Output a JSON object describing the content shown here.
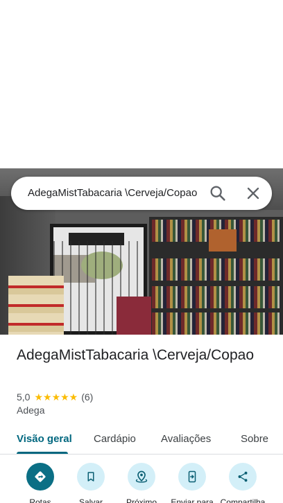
{
  "search": {
    "query": "AdegaMistTabacaria \\Cerveja/Copao"
  },
  "place": {
    "title": "AdegaMistTabacaria \\Cerveja/Copao",
    "rating": "5,0",
    "stars": "★★★★★",
    "review_count": "(6)",
    "category": "Adega",
    "star_color": "#fbbc04"
  },
  "tabs": [
    {
      "label": "Visão geral",
      "active": true
    },
    {
      "label": "Cardápio"
    },
    {
      "label": "Avaliações"
    },
    {
      "label": "Sobre"
    }
  ],
  "actions": [
    {
      "label": "Rotas",
      "icon": "directions-icon"
    },
    {
      "label": "Salvar",
      "icon": "bookmark-icon"
    },
    {
      "label": "Próximo",
      "icon": "nearby-icon"
    },
    {
      "label": "Enviar para",
      "icon": "send-to-phone-icon"
    },
    {
      "label": "Compartilha",
      "icon": "share-icon"
    }
  ],
  "colors": {
    "accent": "#00677f",
    "primary_action": "#0b6f85",
    "action_bg": "#d3eff8"
  }
}
